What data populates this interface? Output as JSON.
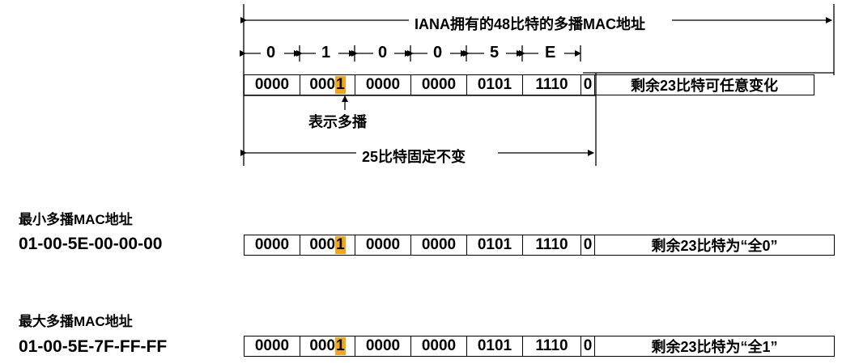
{
  "title": "IANA拥有的48比特的多播MAC地址",
  "hex_digits": [
    "0",
    "1",
    "0",
    "0",
    "5",
    "E"
  ],
  "nibbles": [
    "0000",
    "000",
    "0000",
    "0000",
    "0101",
    "1110",
    "0"
  ],
  "multicast_bit": "1",
  "rows": [
    {
      "remainder_label": "剩余23比特可任意变化"
    },
    {
      "name": "最小多播MAC地址",
      "address": "01-00-5E-00-00-00",
      "remainder_label": "剩余23比特为“全0”"
    },
    {
      "name": "最大多播MAC地址",
      "address": "01-00-5E-7F-FF-FF",
      "remainder_label": "剩余23比特为“全1”"
    }
  ],
  "multicast_note": "表示多播",
  "fixed_label": "25比特固定不变",
  "colors": {
    "highlight": "#f0a818",
    "line": "#000000"
  }
}
